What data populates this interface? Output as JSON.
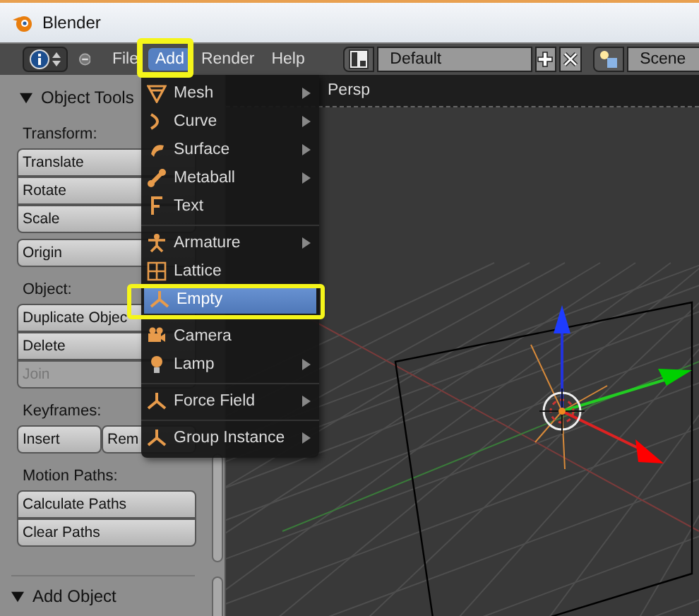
{
  "window": {
    "title": "Blender"
  },
  "menu_bar": {
    "items": [
      {
        "label": "File",
        "selected": false
      },
      {
        "label": "Add",
        "selected": true
      },
      {
        "label": "Render",
        "selected": false
      },
      {
        "label": "Help",
        "selected": false
      }
    ],
    "layout_field": {
      "value": "Default"
    },
    "scene_field": {
      "value": "Scene"
    }
  },
  "tool_panel": {
    "title": "Object Tools",
    "expanded": true,
    "groups": [
      {
        "label": "Transform:",
        "rows": [
          [
            {
              "label": "Translate",
              "disabled": false
            }
          ],
          [
            {
              "label": "Rotate",
              "disabled": false
            }
          ],
          [
            {
              "label": "Scale",
              "disabled": false
            }
          ]
        ]
      },
      {
        "rows": [
          [
            {
              "label": "Origin",
              "disabled": false
            }
          ]
        ]
      },
      {
        "label": "Object:",
        "rows": [
          [
            {
              "label": "Duplicate Objec",
              "disabled": false
            }
          ],
          [
            {
              "label": "Delete",
              "disabled": false
            }
          ],
          [
            {
              "label": "Join",
              "disabled": true
            }
          ]
        ]
      },
      {
        "label": "Keyframes:",
        "rows": [
          [
            {
              "label": "Insert",
              "disabled": false
            },
            {
              "label": "Rem",
              "disabled": false
            }
          ]
        ]
      },
      {
        "label": "Motion Paths:",
        "rows": [
          [
            {
              "label": "Calculate Paths",
              "disabled": false
            }
          ],
          [
            {
              "label": "Clear Paths",
              "disabled": false
            }
          ]
        ]
      }
    ]
  },
  "operator_panel": {
    "title": "Add Object",
    "expanded": true
  },
  "viewport": {
    "label": "Persp"
  },
  "add_menu": {
    "items": [
      {
        "label": "Mesh",
        "submenu": true,
        "selected": false,
        "separator_before": false
      },
      {
        "label": "Curve",
        "submenu": true,
        "selected": false,
        "separator_before": false
      },
      {
        "label": "Surface",
        "submenu": true,
        "selected": false,
        "separator_before": false
      },
      {
        "label": "Metaball",
        "submenu": true,
        "selected": false,
        "separator_before": false
      },
      {
        "label": "Text",
        "submenu": false,
        "selected": false,
        "separator_before": false
      },
      {
        "label": "Armature",
        "submenu": true,
        "selected": false,
        "separator_before": true
      },
      {
        "label": "Lattice",
        "submenu": false,
        "selected": false,
        "separator_before": false
      },
      {
        "label": "Empty",
        "submenu": false,
        "selected": true,
        "separator_before": false
      },
      {
        "label": "Camera",
        "submenu": false,
        "selected": false,
        "separator_before": true
      },
      {
        "label": "Lamp",
        "submenu": true,
        "selected": false,
        "separator_before": false
      },
      {
        "label": "Force Field",
        "submenu": true,
        "selected": false,
        "separator_before": true
      },
      {
        "label": "Group Instance",
        "submenu": true,
        "selected": false,
        "separator_before": true
      }
    ]
  }
}
